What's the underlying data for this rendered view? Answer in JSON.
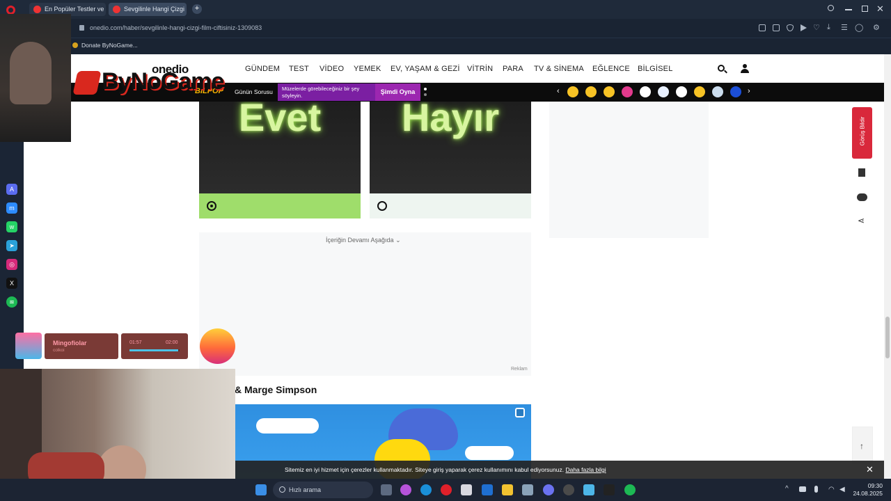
{
  "browser": {
    "tabs": [
      {
        "label": "En Popüler Testler ve Eğle",
        "active": false
      },
      {
        "label": "Sevgilinle Hangi Çizgi Film",
        "active": true
      }
    ],
    "url": "onedio.com/haber/sevgilinle-hangi-cizgi-film-ciftisiniz-1309083",
    "bookmark": "Donate ByNoGame..."
  },
  "overlay": {
    "stream_logo_text": "ByNoGame",
    "music_title": "Mingofiolar",
    "music_artist": "colkoi",
    "music_elapsed": "01:57",
    "music_total": "02:00",
    "music_progress": 0.97
  },
  "header": {
    "logo": "onedio",
    "nav": [
      "GÜNDEM",
      "TEST",
      "VİDEO",
      "YEMEK",
      "EV, YAŞAM & GEZİ",
      "VİTRİN",
      "PARA",
      "TV & SİNEMA",
      "EĞLENCE",
      "BİLGİSEL"
    ]
  },
  "subbar": {
    "brand": "BİLPOP",
    "daily_question": "Günün Sorusu",
    "promo_text": "Müzelerde görebileceğiniz bir şey söyleyin.",
    "play_button": "Şimdi Oyna"
  },
  "poll": {
    "options": [
      {
        "label": "Evet",
        "selected": true
      },
      {
        "label": "Hayır",
        "selected": false
      }
    ]
  },
  "content": {
    "continue_below": "İçeriğin Devamı Aşağıda",
    "ad_label": "Reklam",
    "section_title": "& Marge Simpson"
  },
  "right_rail": {
    "feedback_button": "Görüş Bildir"
  },
  "cookie_banner": {
    "text": "Sitemiz en iyi hizmet için çerezler kullanmaktadır. Siteye giriş yaparak çerez kullanımını kabul ediyorsunuz.",
    "link": "Daha fazla bilgi"
  },
  "taskbar": {
    "search_placeholder": "Hızlı arama",
    "time": "09:30",
    "date": "24.08.2025"
  },
  "colors": {
    "accent_red": "#d9283b",
    "poll_selected": "#9fdd6b",
    "poll_unselected": "#eef5f0",
    "bilpop_purple": "#7b1fa2"
  }
}
